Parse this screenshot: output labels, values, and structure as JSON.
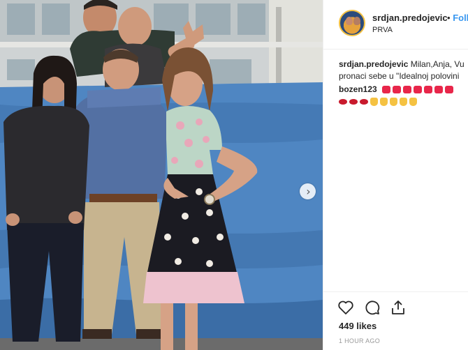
{
  "post": {
    "username": "srdjan.predojevic",
    "separator": "•",
    "follow_label": "Follo",
    "location": "PRVA",
    "caption_user": "srdjan.predojevic",
    "caption_line1": "Milan,Anja, Vu",
    "caption_line2": "pronaci sebe u \"Idealnoj polovini",
    "comment_user": "bozen123",
    "comment_emojis_line1": [
      "heart",
      "heart",
      "heart",
      "heart",
      "heart",
      "heart",
      "heart"
    ],
    "comment_emojis_line2": [
      "lips",
      "lips",
      "lips",
      "clap",
      "clap",
      "clap",
      "clap",
      "clap"
    ],
    "likes": "449 likes",
    "timestamp": "1 HOUR AGO"
  },
  "icons": {
    "like": "heart-outline-icon",
    "comment": "speech-bubble-icon",
    "share": "share-upload-icon",
    "next": "chevron-right-icon"
  },
  "colors": {
    "link": "#3897f0",
    "text": "#262626",
    "muted": "#999999",
    "heart": "#e8264a"
  }
}
